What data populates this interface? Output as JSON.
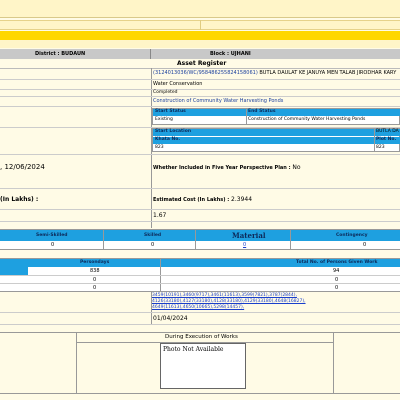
{
  "district_label": "District : BUDAUN",
  "block_label": "Block : UJHANI",
  "asset_register_title": "Asset Register",
  "work_code_line": "(3124013036/WC/958486255824158061)",
  "work_name_line": "BUTLA DAULAT KE JANUYA MEN TALAB JIRODHAR KARY",
  "category": "Water Conservation",
  "status": "Completed",
  "work_title": "Construction of Community Water Harvesting Ponds",
  "status_table": {
    "headers": [
      "Start Status",
      "End Status"
    ],
    "values": [
      "Existing",
      "Construction of Community Water Harvesting Ponds"
    ]
  },
  "location_table": {
    "start_location_label": "Start Location",
    "right_label": "BUTLA DA",
    "khata_label": "Khata No.",
    "plot_label": "Plot No.",
    "khata_value": "823",
    "plot_value": "823"
  },
  "date_text": ", 12/06/2024",
  "five_year_label": "Whether Included in Five Year Perspective Plan :",
  "five_year_value": "No",
  "estimated_cost_label": "Estimated Cost (In Lakhs) :",
  "estimated_cost_value": "2.3944",
  "left_value": "1.67",
  "cost_headers": [
    "Semi-Skilled",
    "Skilled",
    "Material",
    "Contingency"
  ],
  "cost_values": [
    "0",
    "0",
    "0",
    "0"
  ],
  "persondays_headers": [
    "Persondays",
    "Total No. of Persons Given Work"
  ],
  "persondays_rows": [
    [
      "838",
      "94"
    ],
    [
      "0",
      "0"
    ],
    [
      "0",
      "0"
    ]
  ],
  "muster_links_line1": "3459(10191),3460(9717),3461(11613),3599(7821),3787(2844),",
  "muster_links_line2": "4126(33180),4127(33180),4128(33180),4129(33180),4648(16827),",
  "muster_links_line3": "4649(11613),4650(10665),5298(14457),",
  "start_date_value": "01/04/2024",
  "during_execution_label": "During Execution of Works",
  "photo_text": "Photo Not Available",
  "colors": {
    "page_bg": "#fffbe6",
    "yellow_bar": "#ffd700",
    "header_gray": "#c8c8c8",
    "table_blue": "#1ea0e0"
  }
}
